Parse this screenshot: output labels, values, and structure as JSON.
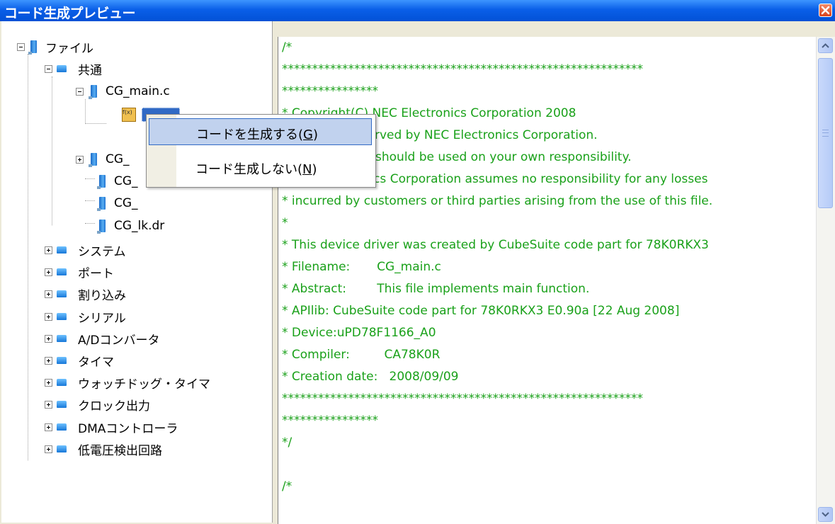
{
  "window": {
    "title": "コード生成プレビュー"
  },
  "tree": {
    "root_label": "ファイル",
    "common_label": "共通",
    "main_file": "CG_main.c",
    "children": [
      "CG_",
      "CG_",
      "CG_",
      "CG_lk.dr"
    ],
    "categories": [
      "システム",
      "ポート",
      "割り込み",
      "シリアル",
      "A/Dコンバータ",
      "タイマ",
      "ウォッチドッグ・タイマ",
      "クロック出力",
      "DMAコントローラ",
      "低電圧検出回路"
    ]
  },
  "context_menu": {
    "items": [
      {
        "label": "コードを生成する(",
        "key": "G",
        "tail": ")"
      },
      {
        "label": "コード生成しない(",
        "key": "N",
        "tail": ")"
      }
    ]
  },
  "code": {
    "lines": [
      "/*",
      "************************************************************",
      "****************",
      "* Copyright(C) NEC Electronics Corporation 2008",
      "* All rights reserved by NEC Electronics Corporation.",
      "* This program should be used on your own responsibility.",
      "* NEC Electronics Corporation assumes no responsibility for any losses",
      "* incurred by customers or third parties arising from the use of this file.",
      "*",
      "* This device driver was created by CubeSuite code part for 78K0RKX3",
      "* Filename:       CG_main.c",
      "* Abstract:        This file implements main function.",
      "* APIlib: CubeSuite code part for 78K0RKX3 E0.90a [22 Aug 2008]",
      "* Device:uPD78F1166_A0",
      "* Compiler:         CA78K0R",
      "* Creation date:   2008/09/09",
      "************************************************************",
      "****************",
      "*/",
      "",
      "/*"
    ]
  },
  "colors": {
    "code_text": "#1aa11a",
    "titlebar": "#0a5fe8",
    "menu_hover": "#c1d2ee"
  },
  "icons": {
    "close": "close-icon",
    "scroll_up": "arrow-up-icon",
    "scroll_down": "arrow-down-icon",
    "file": "file-icon",
    "folder": "folder-icon",
    "function": "function-icon"
  }
}
